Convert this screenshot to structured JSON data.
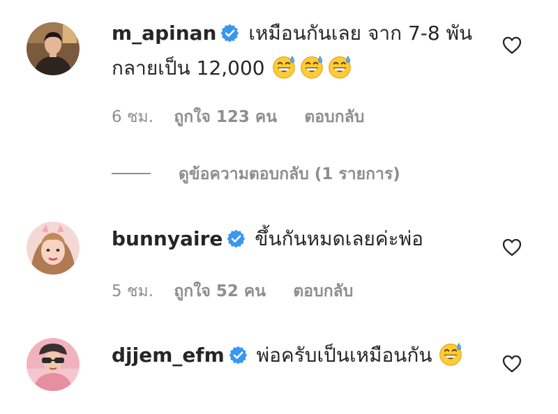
{
  "comments": [
    {
      "username": "m_apinan",
      "verified": true,
      "text": "เหมือนกันเลย จาก 7-8 พัน กลายเป็น 12,000",
      "emojis": [
        "grinning-sweat-emoji",
        "grinning-sweat-emoji",
        "grinning-sweat-emoji"
      ],
      "time": "6 ชม.",
      "likes": "ถูกใจ 123 คน",
      "reply": "ตอบกลับ",
      "view_replies": "ดูข้อความตอบกลับ (1 รายการ)"
    },
    {
      "username": "bunnyaire",
      "verified": true,
      "text": "ขึ้นกันหมดเลยค่ะพ่อ",
      "time": "5 ชม.",
      "likes": "ถูกใจ 52 คน",
      "reply": "ตอบกลับ"
    },
    {
      "username": "djjem_efm",
      "verified": true,
      "text": "พ่อครับเป็นเหมือนกัน",
      "emojis": [
        "grinning-sweat-emoji"
      ]
    }
  ],
  "colors": {
    "text": "#262626",
    "secondary": "#8e8e8e",
    "verified_blue": "#3897f0",
    "emoji_yellow": "#ffcc33",
    "sweat_blue": "#5dadec"
  }
}
